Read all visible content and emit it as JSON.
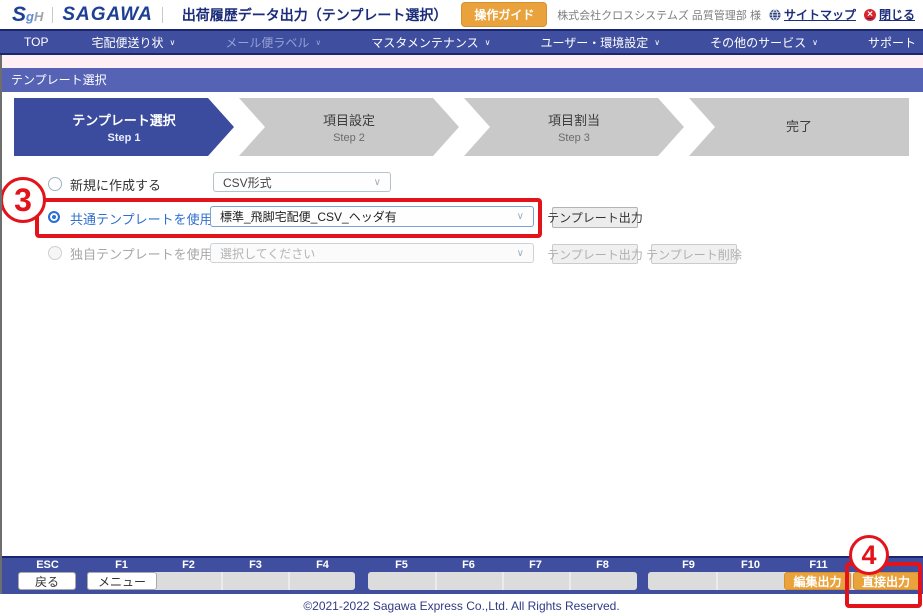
{
  "header": {
    "logo": {
      "s": "S",
      "g": "g",
      "h": "H",
      "brand": "SAGAWA"
    },
    "title": "出荷履歴データ出力（テンプレート選択）",
    "guide_button": "操作ガイド",
    "company": "株式会社クロスシステムズ 品質管理部 様",
    "sitemap_link": "サイトマップ",
    "close_link": "閉じる"
  },
  "nav": {
    "items": [
      {
        "label": "TOP"
      },
      {
        "label": "宅配便送り状"
      },
      {
        "label": "メール便ラベル"
      },
      {
        "label": "マスタメンテナンス"
      },
      {
        "label": "ユーザー・環境設定"
      },
      {
        "label": "その他のサービス"
      },
      {
        "label": "サポート"
      }
    ]
  },
  "section_title": "テンプレート選択",
  "steps": [
    {
      "title": "テンプレート選択",
      "step": "Step 1"
    },
    {
      "title": "項目設定",
      "step": "Step 2"
    },
    {
      "title": "項目割当",
      "step": "Step 3"
    },
    {
      "title": "完了",
      "step": ""
    }
  ],
  "form": {
    "new": {
      "label": "新規に作成する",
      "select_value": "CSV形式"
    },
    "common": {
      "label": "共通テンプレートを使用",
      "select_value": "標準_飛脚宅配便_CSV_ヘッダ有",
      "export_button": "テンプレート出力"
    },
    "own": {
      "label": "独自テンプレートを使用",
      "select_value": "選択してください",
      "export_button": "テンプレート出力",
      "delete_button": "テンプレート削除"
    }
  },
  "annotations": {
    "common_row": "3",
    "direct_output": "4"
  },
  "function_bar": {
    "keys": [
      "ESC",
      "F1",
      "F2",
      "F3",
      "F4",
      "F5",
      "F6",
      "F7",
      "F8",
      "F9",
      "F10",
      "F11"
    ],
    "esc_button": "戻る",
    "f1_button": "メニュー",
    "f11_button": "編集出力",
    "f12_button": "直接出力"
  },
  "footer": {
    "copyright": "©2021-2022 Sagawa Express Co.,Ltd. All Rights Reserved."
  },
  "colors": {
    "accent_orange": "#e9a23c",
    "nav_blue": "#3f4e9f",
    "step_active_blue": "#3b4b9e",
    "annotation_red": "#e3131b",
    "link_navy": "#1c2d7a",
    "selected_radio_blue": "#2a6fd2"
  }
}
